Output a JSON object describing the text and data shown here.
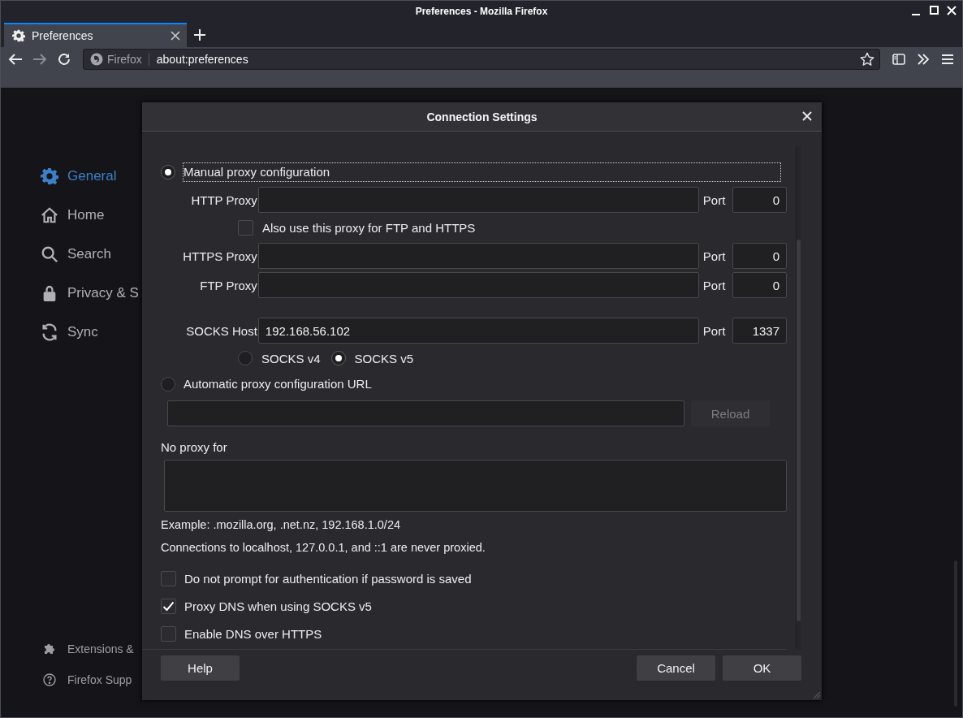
{
  "window": {
    "title": "Preferences - Mozilla Firefox"
  },
  "tabs": [
    {
      "label": "Preferences",
      "selected": true
    }
  ],
  "toolbar": {
    "identity_label": "Firefox",
    "url": "about:preferences"
  },
  "sidebar": {
    "items": [
      {
        "label": "General",
        "selected": true
      },
      {
        "label": "Home",
        "selected": false
      },
      {
        "label": "Search",
        "selected": false
      },
      {
        "label": "Privacy & S",
        "selected": false
      },
      {
        "label": "Sync",
        "selected": false
      }
    ],
    "footer_items": [
      {
        "label": "Extensions &"
      },
      {
        "label": "Firefox Supp"
      }
    ]
  },
  "dialog": {
    "title": "Connection Settings",
    "rows": [
      {
        "kind": "radio",
        "label": "Manual proxy configuration",
        "selected": true,
        "focused": true
      },
      {
        "kind": "proxy",
        "label": "HTTP Proxy",
        "port_label": "Port",
        "port": "0"
      },
      {
        "kind": "sub_checkbox",
        "label": "Also use this proxy for FTP and HTTPS",
        "checked": false
      },
      {
        "kind": "proxy",
        "label": "HTTPS Proxy",
        "port_label": "Port",
        "port": "0"
      },
      {
        "kind": "proxy",
        "label": "FTP Proxy",
        "port_label": "Port",
        "port": "0"
      },
      {
        "kind": "socks",
        "label": "SOCKS Host",
        "value": "192.168.56.102",
        "port_label": "Port",
        "port": "1337"
      },
      {
        "kind": "versions",
        "options": [
          {
            "label": "SOCKS v4",
            "selected": false
          },
          {
            "label": "SOCKS v5",
            "selected": true
          }
        ]
      },
      {
        "kind": "radio",
        "label": "Automatic proxy configuration URL",
        "selected": false,
        "focused": false
      },
      {
        "kind": "url",
        "button": "Reload",
        "disabled": true
      },
      {
        "kind": "label",
        "text": "No proxy for"
      },
      {
        "kind": "textarea"
      },
      {
        "kind": "note",
        "text": "Example: .mozilla.org, .net.nz, 192.168.1.0/24"
      },
      {
        "kind": "note",
        "text": "Connections to localhost, 127.0.0.1, and ::1 are never proxied."
      },
      {
        "kind": "checkbox",
        "label": "Do not prompt for authentication if password is saved",
        "checked": false
      },
      {
        "kind": "checkbox",
        "label": "Proxy DNS when using SOCKS v5",
        "checked": true
      },
      {
        "kind": "checkbox",
        "label": "Enable DNS over HTTPS",
        "checked": false
      }
    ],
    "buttons": [
      {
        "kind": "help",
        "label": "Help"
      },
      {
        "kind": "cancel",
        "label": "Cancel"
      },
      {
        "kind": "ok",
        "label": "OK"
      }
    ]
  }
}
